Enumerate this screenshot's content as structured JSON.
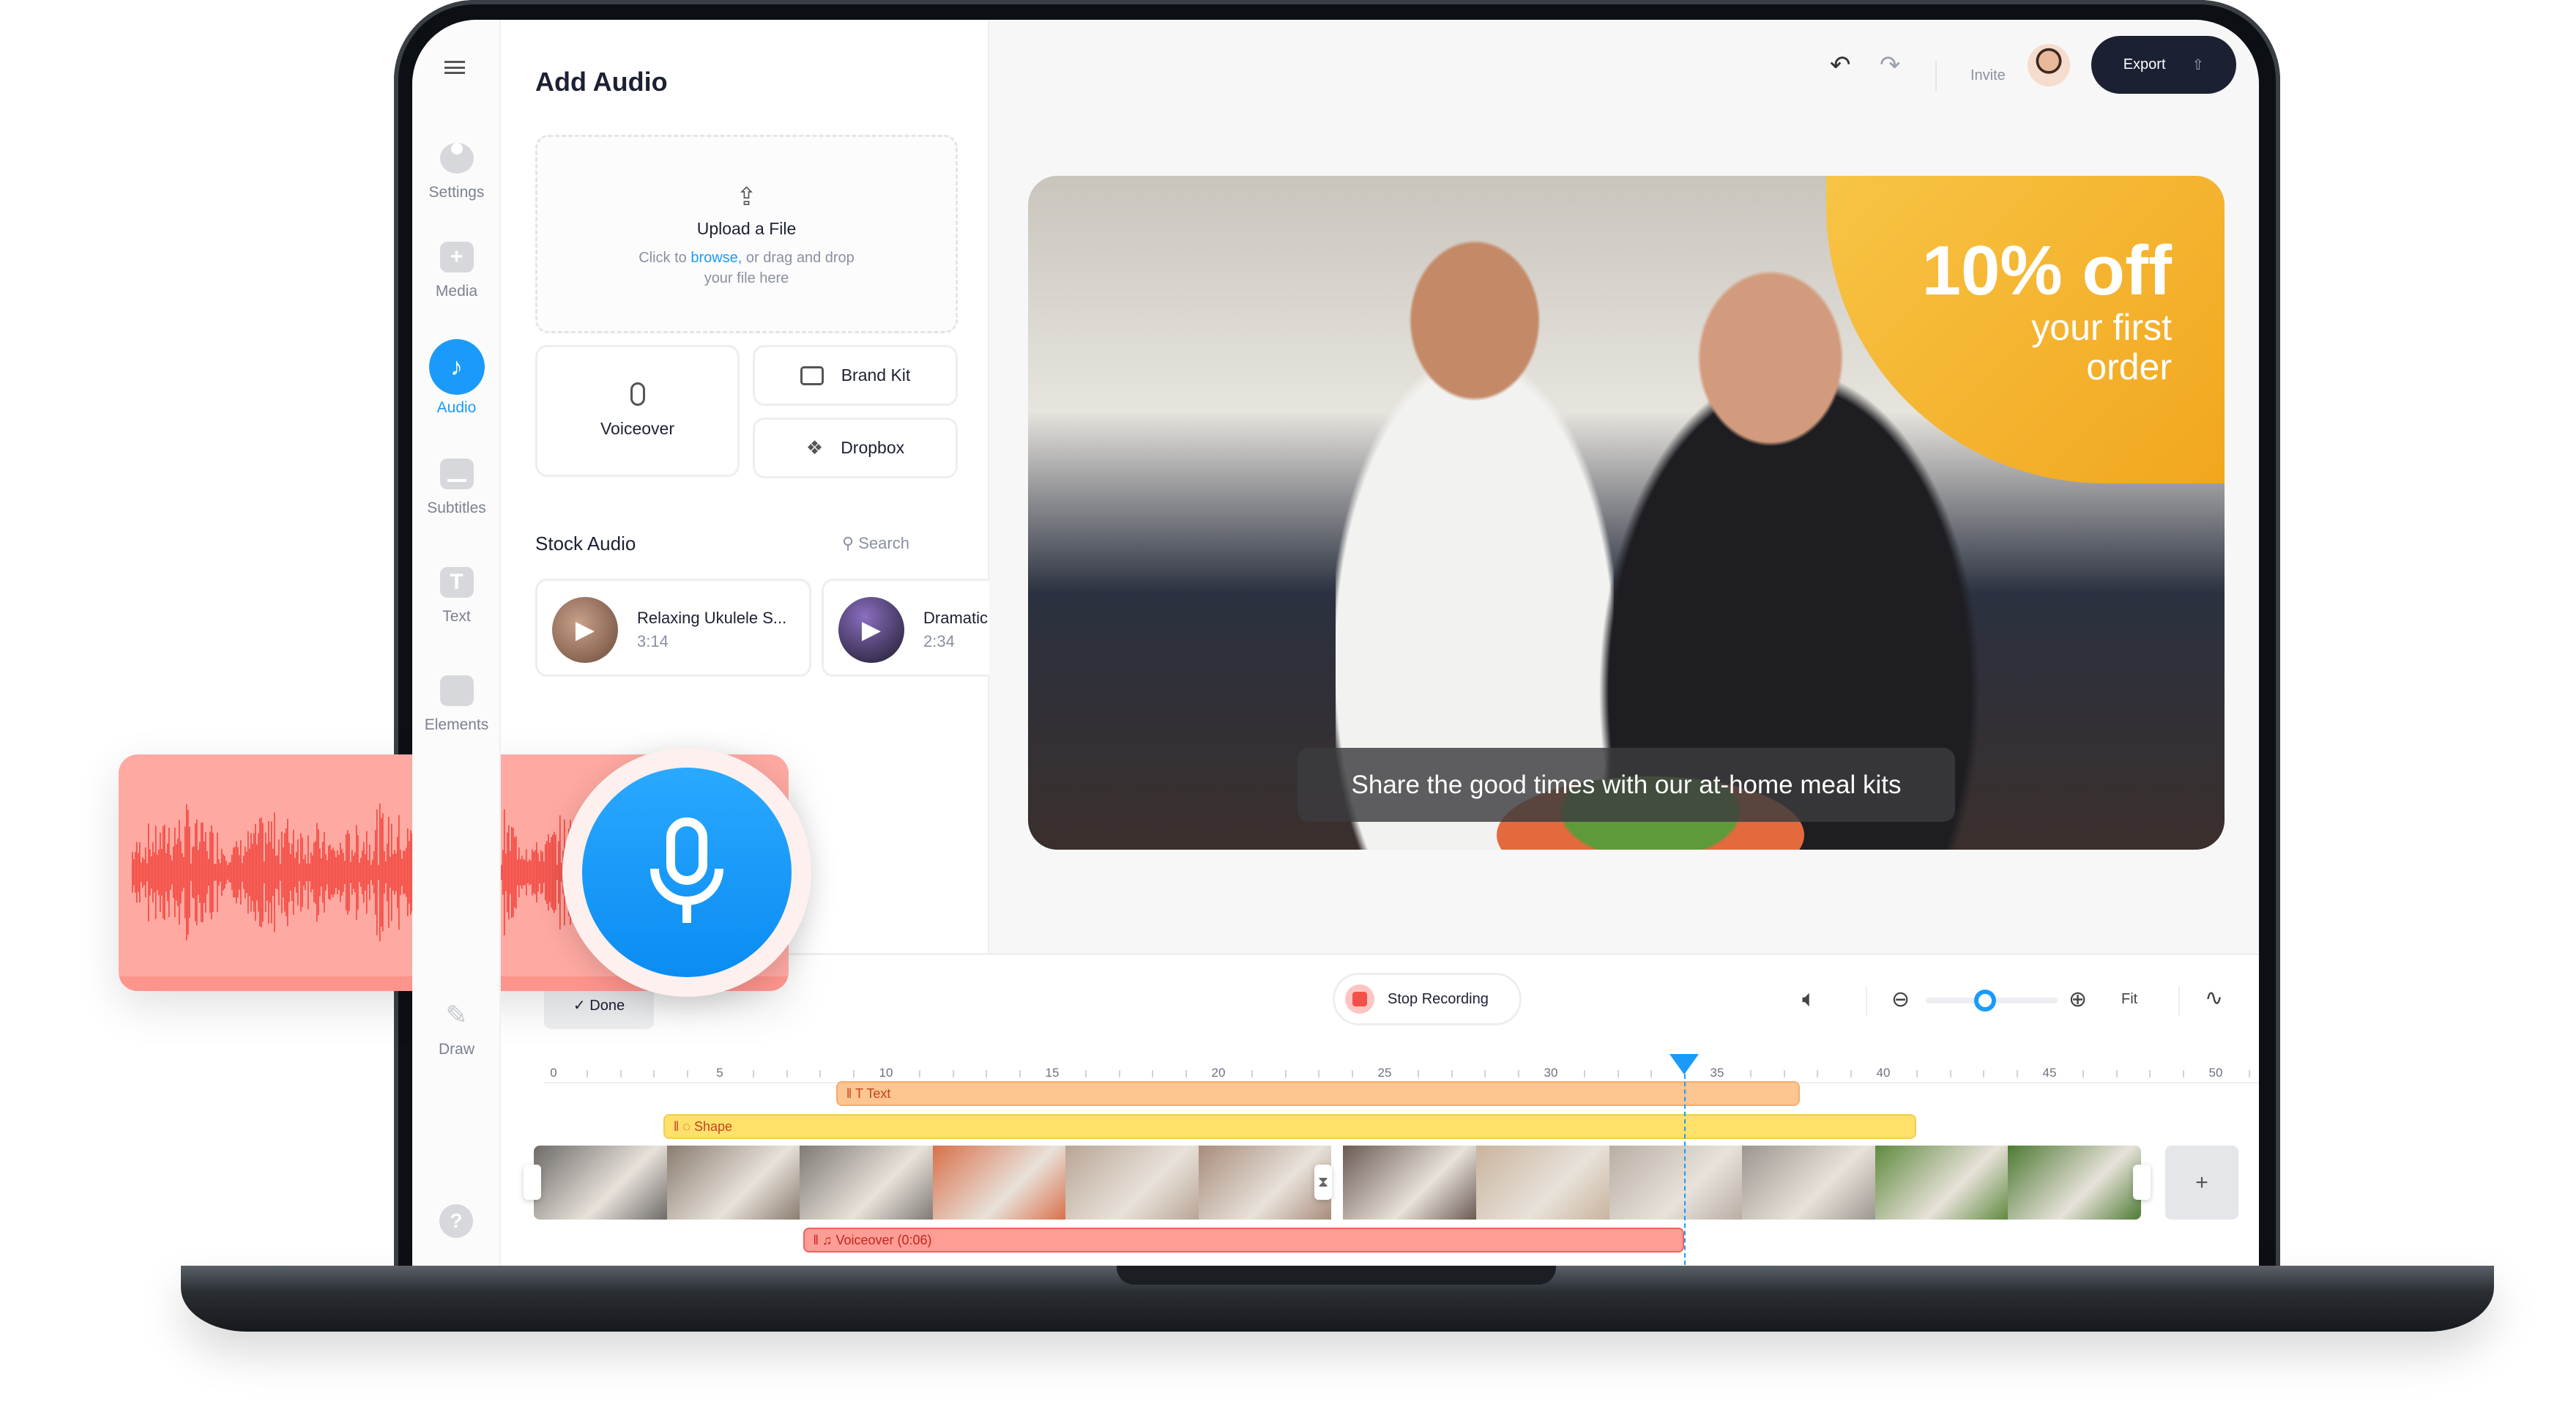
{
  "sidebar": {
    "items": [
      {
        "label": "Settings",
        "icon": "settings-icon"
      },
      {
        "label": "Media",
        "icon": "plus-icon"
      },
      {
        "label": "Audio",
        "icon": "music-note-icon",
        "active": true
      },
      {
        "label": "Subtitles",
        "icon": "subtitles-icon"
      },
      {
        "label": "Text",
        "icon": "text-icon"
      },
      {
        "label": "Elements",
        "icon": "elements-icon"
      },
      {
        "label": "Draw",
        "icon": "pencil-icon"
      }
    ],
    "help": "?"
  },
  "panel": {
    "title": "Add Audio",
    "upload": {
      "title": "Upload a File",
      "hint_pre": "Click to ",
      "link": "browse,",
      "hint_post": " or drag and drop",
      "hint_line2": "your file here"
    },
    "voiceover": "Voiceover",
    "brand_kit": "Brand Kit",
    "dropbox": "Dropbox",
    "stock_title": "Stock Audio",
    "search_placeholder": "Search",
    "stock": [
      {
        "title": "Relaxing Ukulele S...",
        "duration": "3:14"
      },
      {
        "title": "Dramatic",
        "duration": "2:34"
      }
    ]
  },
  "header": {
    "invite": "Invite",
    "export": "Export"
  },
  "video": {
    "promo_big": "10% off",
    "promo_line1": "your first",
    "promo_line2": "order",
    "caption": "Share the good times with our at-home meal kits"
  },
  "recording": {
    "done": "Done",
    "stop": "Stop Recording",
    "zoom_level": 0.45,
    "fit": "Fit"
  },
  "timeline": {
    "ticks": [
      "0",
      "5",
      "10",
      "15",
      "20",
      "25",
      "30",
      "35",
      "40",
      "45",
      "50"
    ],
    "playhead_seconds": 34,
    "tracks": {
      "text": {
        "label": "Text",
        "start": 8.5,
        "end": 37.5
      },
      "shape": {
        "label": "Shape",
        "start": 3.3,
        "end": 41
      },
      "voiceover": {
        "label": "Voiceover (0:06)",
        "start": 7.5,
        "end": 34
      }
    },
    "add": "+"
  },
  "colors": {
    "accent": "#1a9bfc",
    "text_track": "#fdc58f",
    "shape_track": "#fee06b",
    "voice_track": "#fd9d96",
    "record": "#f2514a",
    "export_bg": "#1b2033",
    "promo": "#f6b52a"
  }
}
